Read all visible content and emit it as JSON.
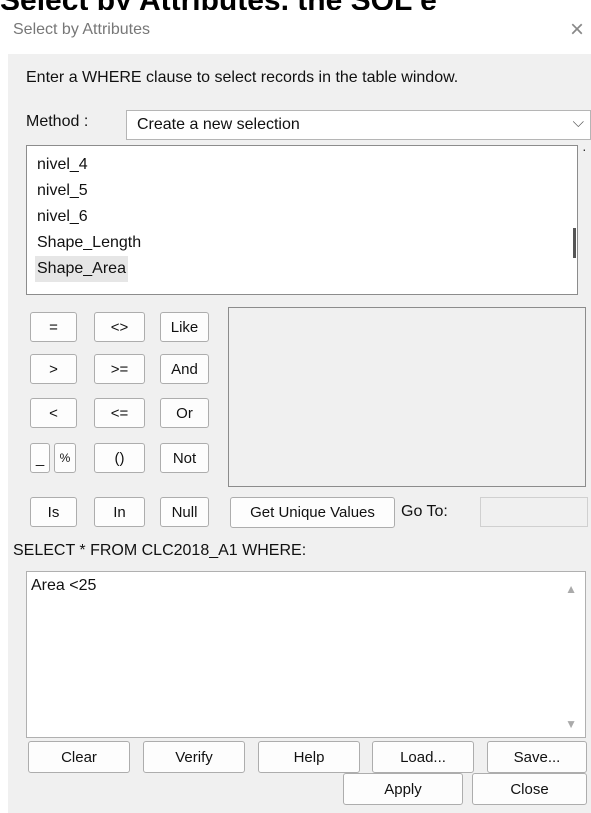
{
  "background": {
    "caption": "Select by Attributes, the SQL e"
  },
  "dialog": {
    "title": "Select by Attributes",
    "close_glyph": "×",
    "instruction": "Enter a WHERE clause to select records in the table window.",
    "method_label": "Method :",
    "method_value": "Create a new selection",
    "fields": [
      "nivel_4",
      "nivel_5",
      "nivel_6",
      "Shape_Length",
      "Shape_Area"
    ],
    "selected_field": "Shape_Area",
    "operators": {
      "eq": "=",
      "ne": "<>",
      "like": "Like",
      "gt": ">",
      "ge": ">=",
      "and": "And",
      "lt": "<",
      "le": "<=",
      "or": "Or",
      "underscore": "_",
      "percent": "%",
      "parens": "()",
      "not": "Not",
      "is": "Is",
      "in": "In",
      "null": "Null"
    },
    "get_unique_values_label": "Get Unique Values",
    "goto_label": "Go To:",
    "goto_value": "",
    "select_statement": "SELECT * FROM CLC2018_A1 WHERE:",
    "expression": "Area <25",
    "buttons": {
      "clear": "Clear",
      "verify": "Verify",
      "help": "Help",
      "load": "Load...",
      "save": "Save...",
      "apply": "Apply",
      "close": "Close"
    },
    "icons": {
      "scroll_up": "▲",
      "scroll_down": "▼",
      "chevron": "⌵",
      "dot": "·"
    }
  }
}
